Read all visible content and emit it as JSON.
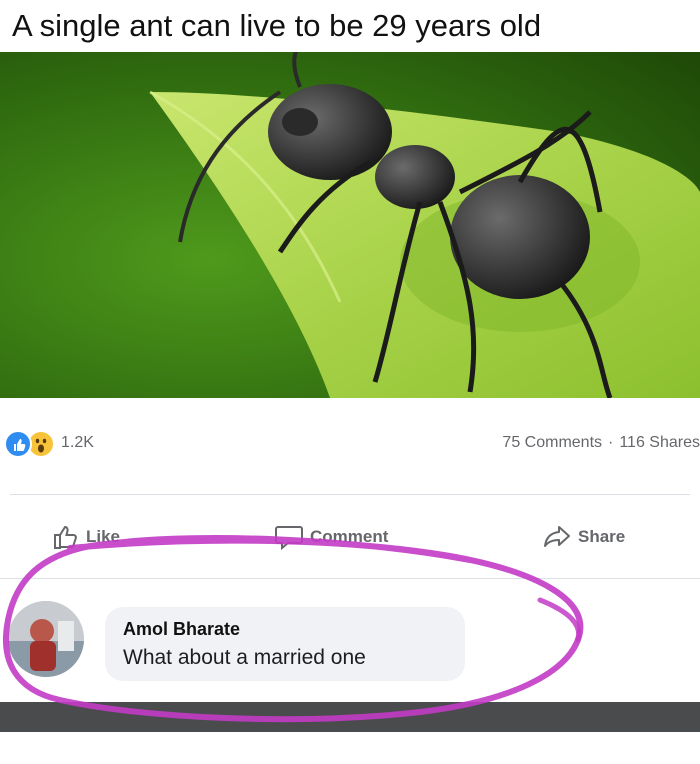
{
  "post": {
    "caption": "A single ant can live to be 29 years old",
    "photo_icon": "ant-on-leaf-photo"
  },
  "reactions": {
    "icons": [
      "like-reaction-icon",
      "wow-reaction-icon"
    ],
    "count": "1.2K",
    "comments_label": "75 Comments",
    "separator": "·",
    "shares_label": "116 Shares"
  },
  "actions": {
    "like_label": "Like",
    "comment_label": "Comment",
    "share_label": "Share"
  },
  "comment": {
    "author": "Amol Bharate",
    "text": "What about a married one"
  },
  "colors": {
    "like_blue": "#2f8cf0",
    "wow_yellow": "#f7c33a",
    "meta_gray": "#65676b",
    "annotation_magenta": "#c23bc6"
  }
}
